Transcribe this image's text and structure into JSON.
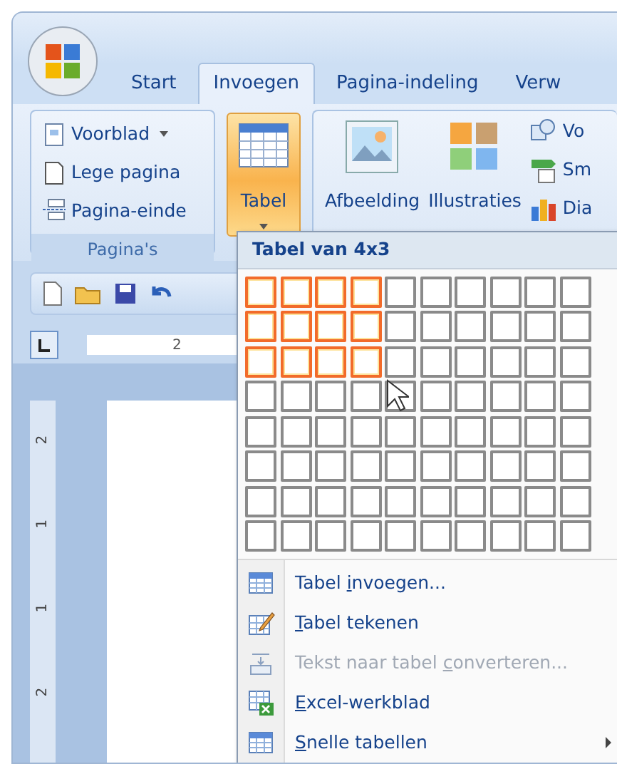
{
  "tabs": [
    {
      "label": "Start",
      "selected": false
    },
    {
      "label": "Invoegen",
      "selected": true
    },
    {
      "label": "Pagina-indeling",
      "selected": false
    },
    {
      "label": "Verw",
      "selected": false
    }
  ],
  "ribbon": {
    "pages_group": {
      "label": "Pagina's",
      "items": [
        {
          "kind": "cover",
          "label": "Voorblad",
          "dropdown": true
        },
        {
          "kind": "blank",
          "label": "Lege pagina",
          "dropdown": false
        },
        {
          "kind": "break",
          "label": "Pagina-einde",
          "dropdown": false
        }
      ]
    },
    "table_button": {
      "label": "Tabel",
      "pressed": true
    },
    "illustrations": [
      {
        "kind": "picture",
        "label": "Afbeelding"
      },
      {
        "kind": "clipart",
        "label": "Illustraties"
      }
    ],
    "small_items": [
      {
        "kind": "shapes",
        "label": "Vo"
      },
      {
        "kind": "smartart",
        "label": "Sm"
      },
      {
        "kind": "chart",
        "label": "Dia"
      }
    ]
  },
  "ruler": {
    "label": "2"
  },
  "vertical_ruler": [
    "2",
    "1",
    "1",
    "2"
  ],
  "table_menu": {
    "title": "Tabel van 4x3",
    "grid": [
      {
        "cells": [
          {
            "selected": true
          },
          {
            "selected": true
          },
          {
            "selected": true
          },
          {
            "selected": true
          },
          {
            "selected": false
          },
          {
            "selected": false
          },
          {
            "selected": false
          },
          {
            "selected": false
          },
          {
            "selected": false
          },
          {
            "selected": false
          }
        ]
      },
      {
        "cells": [
          {
            "selected": true
          },
          {
            "selected": true
          },
          {
            "selected": true
          },
          {
            "selected": true
          },
          {
            "selected": false
          },
          {
            "selected": false
          },
          {
            "selected": false
          },
          {
            "selected": false
          },
          {
            "selected": false
          },
          {
            "selected": false
          }
        ]
      },
      {
        "cells": [
          {
            "selected": true
          },
          {
            "selected": true
          },
          {
            "selected": true
          },
          {
            "selected": true
          },
          {
            "selected": false
          },
          {
            "selected": false
          },
          {
            "selected": false
          },
          {
            "selected": false
          },
          {
            "selected": false
          },
          {
            "selected": false
          }
        ]
      },
      {
        "cells": [
          {
            "selected": false
          },
          {
            "selected": false
          },
          {
            "selected": false
          },
          {
            "selected": false
          },
          {
            "selected": false
          },
          {
            "selected": false
          },
          {
            "selected": false
          },
          {
            "selected": false
          },
          {
            "selected": false
          },
          {
            "selected": false
          }
        ]
      },
      {
        "cells": [
          {
            "selected": false
          },
          {
            "selected": false
          },
          {
            "selected": false
          },
          {
            "selected": false
          },
          {
            "selected": false
          },
          {
            "selected": false
          },
          {
            "selected": false
          },
          {
            "selected": false
          },
          {
            "selected": false
          },
          {
            "selected": false
          }
        ]
      },
      {
        "cells": [
          {
            "selected": false
          },
          {
            "selected": false
          },
          {
            "selected": false
          },
          {
            "selected": false
          },
          {
            "selected": false
          },
          {
            "selected": false
          },
          {
            "selected": false
          },
          {
            "selected": false
          },
          {
            "selected": false
          },
          {
            "selected": false
          }
        ]
      },
      {
        "cells": [
          {
            "selected": false
          },
          {
            "selected": false
          },
          {
            "selected": false
          },
          {
            "selected": false
          },
          {
            "selected": false
          },
          {
            "selected": false
          },
          {
            "selected": false
          },
          {
            "selected": false
          },
          {
            "selected": false
          },
          {
            "selected": false
          }
        ]
      },
      {
        "cells": [
          {
            "selected": false
          },
          {
            "selected": false
          },
          {
            "selected": false
          },
          {
            "selected": false
          },
          {
            "selected": false
          },
          {
            "selected": false
          },
          {
            "selected": false
          },
          {
            "selected": false
          },
          {
            "selected": false
          },
          {
            "selected": false
          }
        ]
      }
    ],
    "items": [
      {
        "kind": "insert",
        "label": {
          "before": "Tabel ",
          "key": "i",
          "after": "nvoegen..."
        },
        "disabled": false,
        "submenu": false
      },
      {
        "kind": "draw",
        "label": {
          "key": "T",
          "after": "abel tekenen"
        },
        "disabled": false,
        "submenu": false
      },
      {
        "kind": "convert",
        "label": {
          "before": "Tekst naar tabel ",
          "key": "c",
          "after": "onverteren..."
        },
        "disabled": true,
        "submenu": false
      },
      {
        "kind": "excel",
        "label": {
          "key": "E",
          "after": "xcel-werkblad"
        },
        "disabled": false,
        "submenu": false
      },
      {
        "kind": "quick",
        "label": {
          "key": "S",
          "after": "nelle tabellen"
        },
        "disabled": false,
        "submenu": true
      }
    ]
  }
}
